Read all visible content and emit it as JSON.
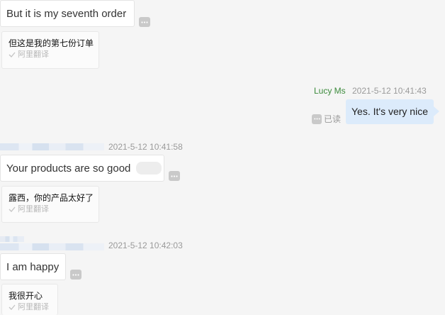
{
  "messages": [
    {
      "text": "But it is my seventh order",
      "translation": "但这是我的第七份订单",
      "translation_source": "阿里翻译"
    },
    {
      "sender": "Lucy Ms",
      "time": "2021-5-12 10:41:43",
      "text": "Yes. It's very nice",
      "read_status": "已读"
    },
    {
      "time": "2021-5-12 10:41:58",
      "text": "Your products are so good",
      "translation": "露西，你的产品太好了",
      "translation_source": "阿里翻译"
    },
    {
      "time": "2021-5-12 10:42:03",
      "text": "I am happy",
      "translation": "我很开心",
      "translation_source": "阿里翻译"
    }
  ],
  "icons": {
    "more": "more-dots-icon",
    "check": "check-icon",
    "read": "read-dots-icon"
  },
  "colors": {
    "outgoing_bubble": "#dcebfb",
    "sender_name": "#3b8a3b",
    "timestamp": "#9a9a9a"
  }
}
